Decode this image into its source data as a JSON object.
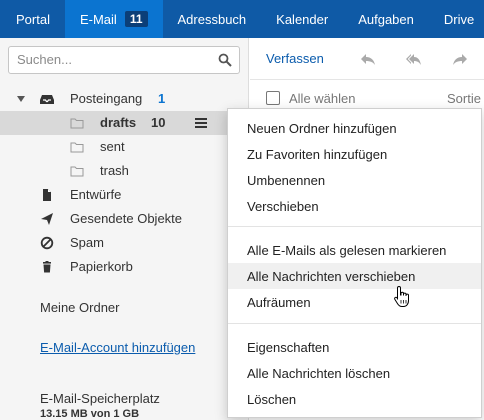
{
  "topnav": {
    "items": [
      {
        "label": "Portal"
      },
      {
        "label": "E-Mail",
        "badge": "11",
        "active": true
      },
      {
        "label": "Adressbuch"
      },
      {
        "label": "Kalender"
      },
      {
        "label": "Aufgaben"
      },
      {
        "label": "Drive"
      }
    ]
  },
  "search": {
    "placeholder": "Suchen..."
  },
  "folders": {
    "inbox": {
      "label": "Posteingang",
      "count": "1"
    },
    "drafts_sub": {
      "label": "drafts",
      "count": "10"
    },
    "sent_sub": {
      "label": "sent"
    },
    "trash_sub": {
      "label": "trash"
    },
    "drafts": {
      "label": "Entwürfe"
    },
    "sent": {
      "label": "Gesendete Objekte"
    },
    "spam": {
      "label": "Spam"
    },
    "trash": {
      "label": "Papierkorb"
    }
  },
  "sidebar": {
    "my_folders": "Meine Ordner",
    "add_account": "E-Mail-Account hinzufügen",
    "quota_title": "E-Mail-Speicherplatz",
    "quota_value": "13.15 MB von 1 GB"
  },
  "toolbar": {
    "compose": "Verfassen"
  },
  "list": {
    "select_all": "Alle wählen",
    "sort": "Sortie"
  },
  "context_menu": {
    "group1": [
      "Neuen Ordner hinzufügen",
      "Zu Favoriten hinzufügen",
      "Umbenennen",
      "Verschieben"
    ],
    "group2": [
      "Alle E-Mails als gelesen markieren",
      "Alle Nachrichten verschieben",
      "Aufräumen"
    ],
    "group3": [
      "Eigenschaften",
      "Alle Nachrichten löschen",
      "Löschen"
    ],
    "hovered": "Alle Nachrichten verschieben"
  },
  "colors": {
    "nav_bg": "#0f5aa6",
    "nav_active": "#0b74d0",
    "link": "#0b5cad",
    "selected_row": "#d9d9d9"
  }
}
